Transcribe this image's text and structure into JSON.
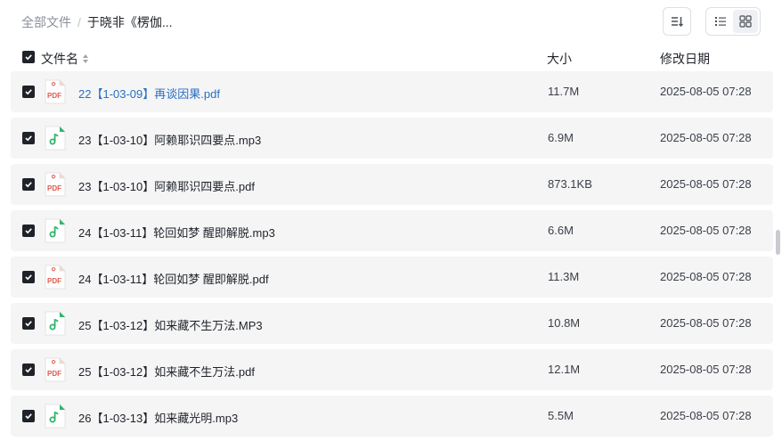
{
  "breadcrumb": {
    "root": "全部文件",
    "separator": "/",
    "current": "于晓非《楞伽..."
  },
  "columns": {
    "name": "文件名",
    "size": "大小",
    "date": "修改日期"
  },
  "files": [
    {
      "type": "pdf",
      "name": "22【1-03-09】再谈因果.pdf",
      "size": "11.7M",
      "date": "2025-08-05 07:28",
      "highlight": true
    },
    {
      "type": "audio",
      "name": "23【1-03-10】阿赖耶识四要点.mp3",
      "size": "6.9M",
      "date": "2025-08-05 07:28",
      "highlight": false
    },
    {
      "type": "pdf",
      "name": "23【1-03-10】阿赖耶识四要点.pdf",
      "size": "873.1KB",
      "date": "2025-08-05 07:28",
      "highlight": false
    },
    {
      "type": "audio",
      "name": "24【1-03-11】轮回如梦 醒即解脱.mp3",
      "size": "6.6M",
      "date": "2025-08-05 07:28",
      "highlight": false
    },
    {
      "type": "pdf",
      "name": "24【1-03-11】轮回如梦 醒即解脱.pdf",
      "size": "11.3M",
      "date": "2025-08-05 07:28",
      "highlight": false
    },
    {
      "type": "audio",
      "name": "25【1-03-12】如来藏不生万法.MP3",
      "size": "10.8M",
      "date": "2025-08-05 07:28",
      "highlight": false
    },
    {
      "type": "pdf",
      "name": "25【1-03-12】如来藏不生万法.pdf",
      "size": "12.1M",
      "date": "2025-08-05 07:28",
      "highlight": false
    },
    {
      "type": "audio",
      "name": "26【1-03-13】如来藏光明.mp3",
      "size": "5.5M",
      "date": "2025-08-05 07:28",
      "highlight": false
    }
  ],
  "icons": {
    "pdf_label": "PDF",
    "pdf_color": "#e2574c",
    "audio_color": "#2fb56a",
    "checkbox_color": "#1f2329",
    "link_color": "#2a6ec2"
  }
}
